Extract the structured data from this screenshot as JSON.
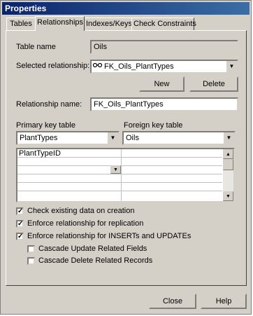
{
  "window": {
    "title": "Properties"
  },
  "tabs": [
    {
      "label": "Tables",
      "active": false
    },
    {
      "label": "Relationships",
      "active": true
    },
    {
      "label": "Indexes/Keys",
      "active": false
    },
    {
      "label": "Check Constraints",
      "active": false
    }
  ],
  "form": {
    "table_name_label": "Table name",
    "table_name_value": "Oils",
    "selected_relationship_label": "Selected relationship:",
    "selected_relationship_value": "FK_Oils_PlantTypes",
    "new_button": "New",
    "delete_button": "Delete",
    "relationship_name_label": "Relationship name:",
    "relationship_name_value": "FK_Oils_PlantTypes",
    "primary_key_table_label": "Primary key table",
    "primary_key_table_value": "PlantTypes",
    "foreign_key_table_label": "Foreign key table",
    "foreign_key_table_value": "Oils",
    "key_rows": [
      {
        "primary": "PlantTypeID",
        "foreign": ""
      },
      {
        "primary": "",
        "foreign": ""
      },
      {
        "primary": "",
        "foreign": ""
      },
      {
        "primary": "",
        "foreign": ""
      },
      {
        "primary": "",
        "foreign": ""
      },
      {
        "primary": "",
        "foreign": ""
      }
    ]
  },
  "options": [
    {
      "label": "Check existing data on creation",
      "checked": true
    },
    {
      "label": "Enforce relationship for replication",
      "checked": true
    },
    {
      "label": "Enforce relationship for INSERTs and UPDATEs",
      "checked": true
    },
    {
      "label": "Cascade Update Related Fields",
      "checked": false
    },
    {
      "label": "Cascade Delete Related Records",
      "checked": false
    }
  ],
  "footer": {
    "close_button": "Close",
    "help_button": "Help"
  },
  "icons": {
    "relationship": "relationship-icon",
    "dropdown": "chevron-down-icon",
    "check": "checkmark-icon"
  }
}
